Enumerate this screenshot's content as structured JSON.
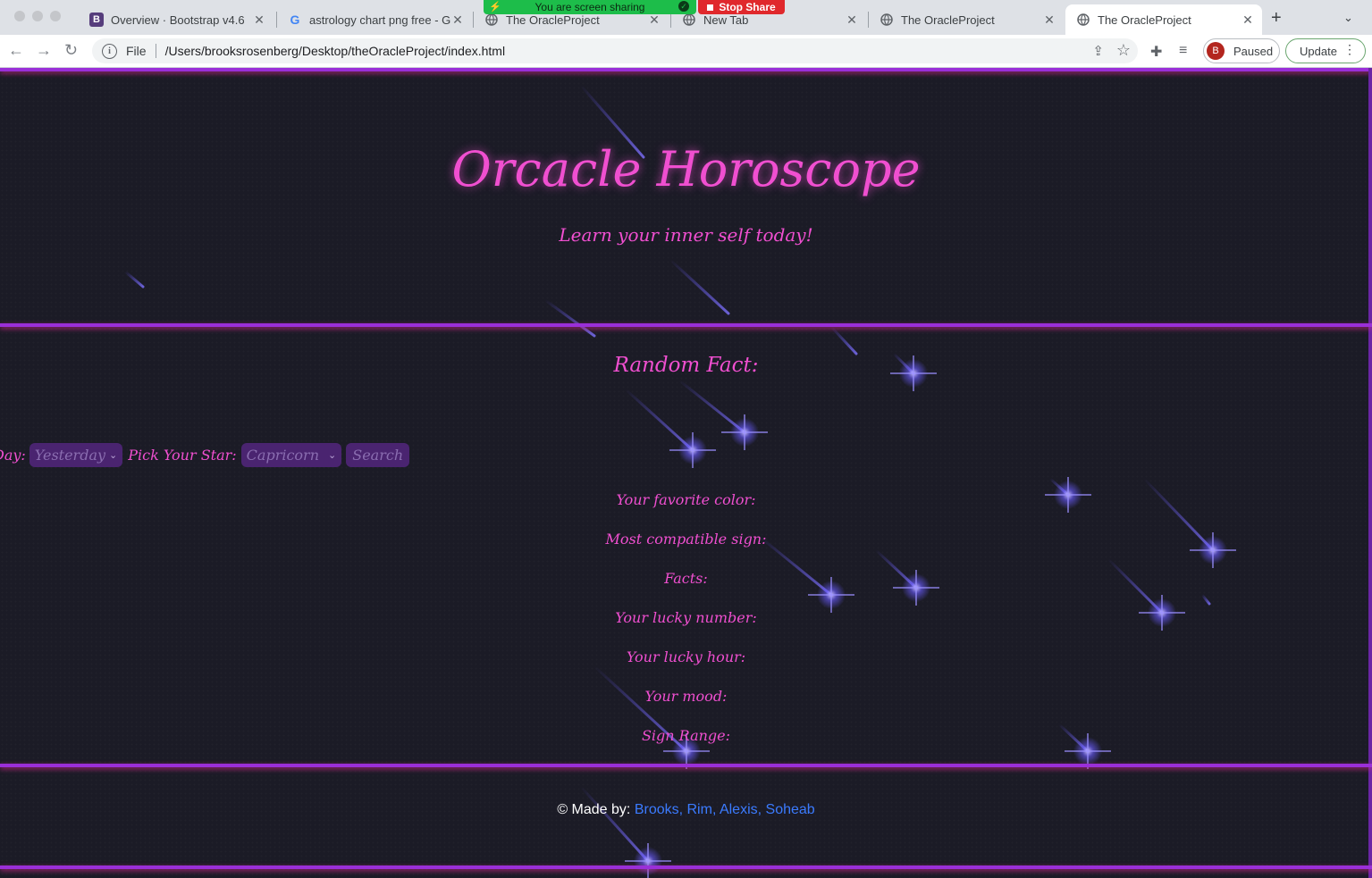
{
  "browser": {
    "tabs": [
      {
        "title": "Overview · Bootstrap v4.6",
        "favicon": "bootstrap-icon",
        "active": false
      },
      {
        "title": "astrology chart png free - G",
        "favicon": "google-icon",
        "active": false
      },
      {
        "title": "The OracleProject",
        "favicon": "globe-icon",
        "active": false
      },
      {
        "title": "New Tab",
        "favicon": "globe-icon",
        "active": false
      },
      {
        "title": "The OracleProject",
        "favicon": "globe-icon",
        "active": false
      },
      {
        "title": "The OracleProject",
        "favicon": "globe-icon",
        "active": true
      }
    ],
    "screen_share": {
      "status": "You are screen sharing",
      "stop_label": "Stop Share"
    },
    "address": {
      "scheme": "File",
      "url": "/Users/brooksrosenberg/Desktop/theOracleProject/index.html"
    },
    "profile": {
      "initial": "B",
      "status": "Paused"
    },
    "update_label": "Update"
  },
  "page": {
    "title": "Orcacle Horoscope",
    "tagline": "Learn your inner self today!",
    "fact_heading": "Random Fact:",
    "controls": {
      "day_label": "Day:",
      "day_value": "Yesterday",
      "star_label": "Pick Your Star:",
      "star_value": "Capricorn",
      "search_label": "Search"
    },
    "info_fields": [
      "Your favorite color:",
      "Most compatible sign:",
      "Facts:",
      "Your lucky number:",
      "Your lucky hour:",
      "Your mood:",
      "Sign Range:"
    ],
    "footer": {
      "prefix": "© Made by:",
      "names": "Brooks, Rim, Alexis, Soheab"
    }
  },
  "colors": {
    "background": "#1b1b26",
    "accent_pink": "#f04fd0",
    "border_purple": "#9a2fd8",
    "control_purple": "#4a2470",
    "link_blue": "#3b7bff",
    "star_blue": "#6a5cff"
  }
}
